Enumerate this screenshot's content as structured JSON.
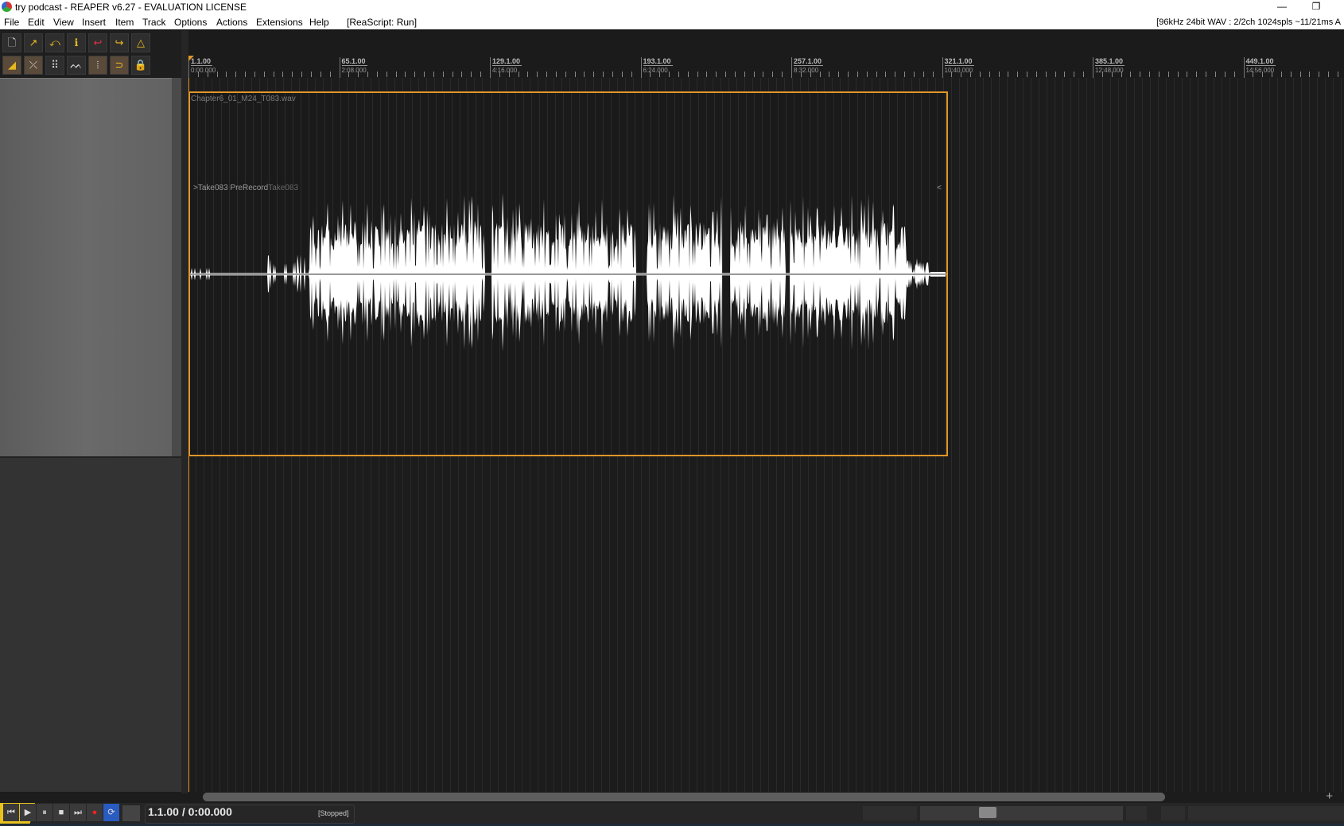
{
  "window": {
    "title": "try podcast - REAPER v6.27 - EVALUATION LICENSE",
    "minimize_icon": "minimize-icon",
    "restore_icon": "restore-icon"
  },
  "menu": {
    "items": [
      "File",
      "Edit",
      "View",
      "Insert",
      "Item",
      "Track",
      "Options",
      "Actions",
      "Extensions",
      "Help",
      "[ReaScript: Run]"
    ],
    "status": "[96kHz 24bit WAV : 2/2ch 1024spls ~11/21ms A"
  },
  "toolbar": {
    "row1": [
      {
        "name": "new-project-icon",
        "glyph": "🗋"
      },
      {
        "name": "open-project-icon",
        "glyph": "↗"
      },
      {
        "name": "save-project-icon",
        "glyph": "⤺"
      },
      {
        "name": "project-settings-icon",
        "glyph": "ℹ"
      },
      {
        "name": "undo-icon",
        "glyph": "↩"
      },
      {
        "name": "redo-icon",
        "glyph": "↪"
      },
      {
        "name": "metronome-icon",
        "glyph": "△"
      }
    ],
    "row2": [
      {
        "name": "auto-crossfade-icon",
        "glyph": "◢",
        "active": true
      },
      {
        "name": "ripple-edit-icon",
        "glyph": "⤫",
        "active": true
      },
      {
        "name": "grid-icon",
        "glyph": "⠿",
        "active": false
      },
      {
        "name": "envelope-points-icon",
        "glyph": "ᨓ",
        "active": false
      },
      {
        "name": "snap-icon",
        "glyph": "⦙",
        "active": true
      },
      {
        "name": "loop-icon",
        "glyph": "⊃",
        "active": true
      },
      {
        "name": "lock-icon",
        "glyph": "🔒",
        "active": false
      }
    ]
  },
  "ruler": {
    "markers": [
      {
        "measure": "1.1.00",
        "time": "0:00.000"
      },
      {
        "measure": "65.1.00",
        "time": "2:08.000"
      },
      {
        "measure": "129.1.00",
        "time": "4:16.000"
      },
      {
        "measure": "193.1.00",
        "time": "6:24.000"
      },
      {
        "measure": "257.1.00",
        "time": "8:32.000"
      },
      {
        "measure": "321.1.00",
        "time": "10:40.000"
      },
      {
        "measure": "385.1.00",
        "time": "12:48.000"
      },
      {
        "measure": "449.1.00",
        "time": "14:56.000"
      }
    ]
  },
  "item": {
    "name": "Chapter6_01_M24_T083.wav",
    "take_label": ">Take083 PreRecord",
    "take_label_dim": "Take083",
    "end_arrow": "<",
    "selected_color": "#e0962a"
  },
  "transport": {
    "buttons": [
      {
        "name": "go-to-start-button",
        "glyph": "⏮"
      },
      {
        "name": "play-button",
        "glyph": "▶"
      },
      {
        "name": "pause-button",
        "glyph": "⏸"
      },
      {
        "name": "stop-button",
        "glyph": "■"
      },
      {
        "name": "go-to-end-button",
        "glyph": "⏭"
      },
      {
        "name": "record-button",
        "glyph": "●"
      },
      {
        "name": "repeat-button",
        "glyph": "⟳"
      }
    ],
    "position": "1.1.00 / 0:00.000",
    "state": "[Stopped]"
  },
  "scroll": {
    "zoom_in": "+"
  }
}
